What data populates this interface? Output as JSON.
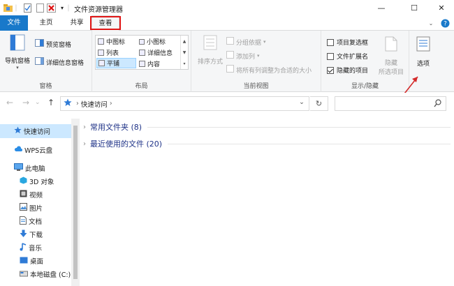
{
  "window": {
    "title": "文件资源管理器",
    "controls": {
      "minimize": "—",
      "maximize": "☐",
      "close": "✕"
    }
  },
  "quick_access_toolbar": {
    "icons": [
      "folder-icon",
      "properties-icon",
      "new-folder-icon",
      "delete-icon",
      "customize-dropdown-icon"
    ],
    "dropdown": "▾"
  },
  "tabs": {
    "file": "文件",
    "home": "主页",
    "share": "共享",
    "view": "查看",
    "selected": "查看"
  },
  "ribbon": {
    "panes": {
      "label": "窗格",
      "nav_pane": "导航窗格",
      "preview_pane": "预览窗格",
      "details_pane": "详细信息窗格"
    },
    "layout": {
      "label": "布局",
      "items": [
        "中图标",
        "小图标",
        "列表",
        "详细信息",
        "平铺",
        "内容"
      ],
      "selected": "平铺"
    },
    "current_view": {
      "label": "当前视图",
      "sort_by": "排序方式",
      "group_by": "分组依据",
      "add_column": "添加列",
      "size_all_columns": "将所有列调整为合适的大小"
    },
    "show_hide": {
      "label": "显示/隐藏",
      "item_checkboxes": {
        "text": "项目复选框",
        "checked": false
      },
      "file_extensions": {
        "text": "文件扩展名",
        "checked": false
      },
      "hidden_items": {
        "text": "隐藏的项目",
        "checked": true
      },
      "hide": "隐藏",
      "hide_selected": "所选项目"
    },
    "options": "选项"
  },
  "address_bar": {
    "path": "快速访问",
    "separator": "›",
    "back": "←",
    "forward": "→",
    "recent": "⌄",
    "up": "↑",
    "dropdown": "⌄",
    "refresh": "↻",
    "search_placeholder": ""
  },
  "nav_pane": {
    "items": [
      {
        "label": "快速访问",
        "icon": "star-icon",
        "selected": true
      },
      {
        "label": "WPS云盘",
        "icon": "cloud-icon"
      },
      {
        "label": "此电脑",
        "icon": "computer-icon"
      },
      {
        "label": "3D 对象",
        "icon": "3d-objects-icon"
      },
      {
        "label": "视频",
        "icon": "video-icon"
      },
      {
        "label": "图片",
        "icon": "pictures-icon"
      },
      {
        "label": "文档",
        "icon": "documents-icon"
      },
      {
        "label": "下载",
        "icon": "download-icon"
      },
      {
        "label": "音乐",
        "icon": "music-icon"
      },
      {
        "label": "桌面",
        "icon": "desktop-icon"
      },
      {
        "label": "本地磁盘 (C:)",
        "icon": "drive-icon"
      }
    ]
  },
  "content": {
    "groups": [
      {
        "label": "常用文件夹 (8)"
      },
      {
        "label": "最近使用的文件 (20)"
      }
    ]
  },
  "colors": {
    "accent": "#1979ca",
    "highlight_box": "#e01616",
    "annotation_arrow": "#d42a2a",
    "selection": "#cce8ff",
    "group_header": "#1e3287"
  }
}
